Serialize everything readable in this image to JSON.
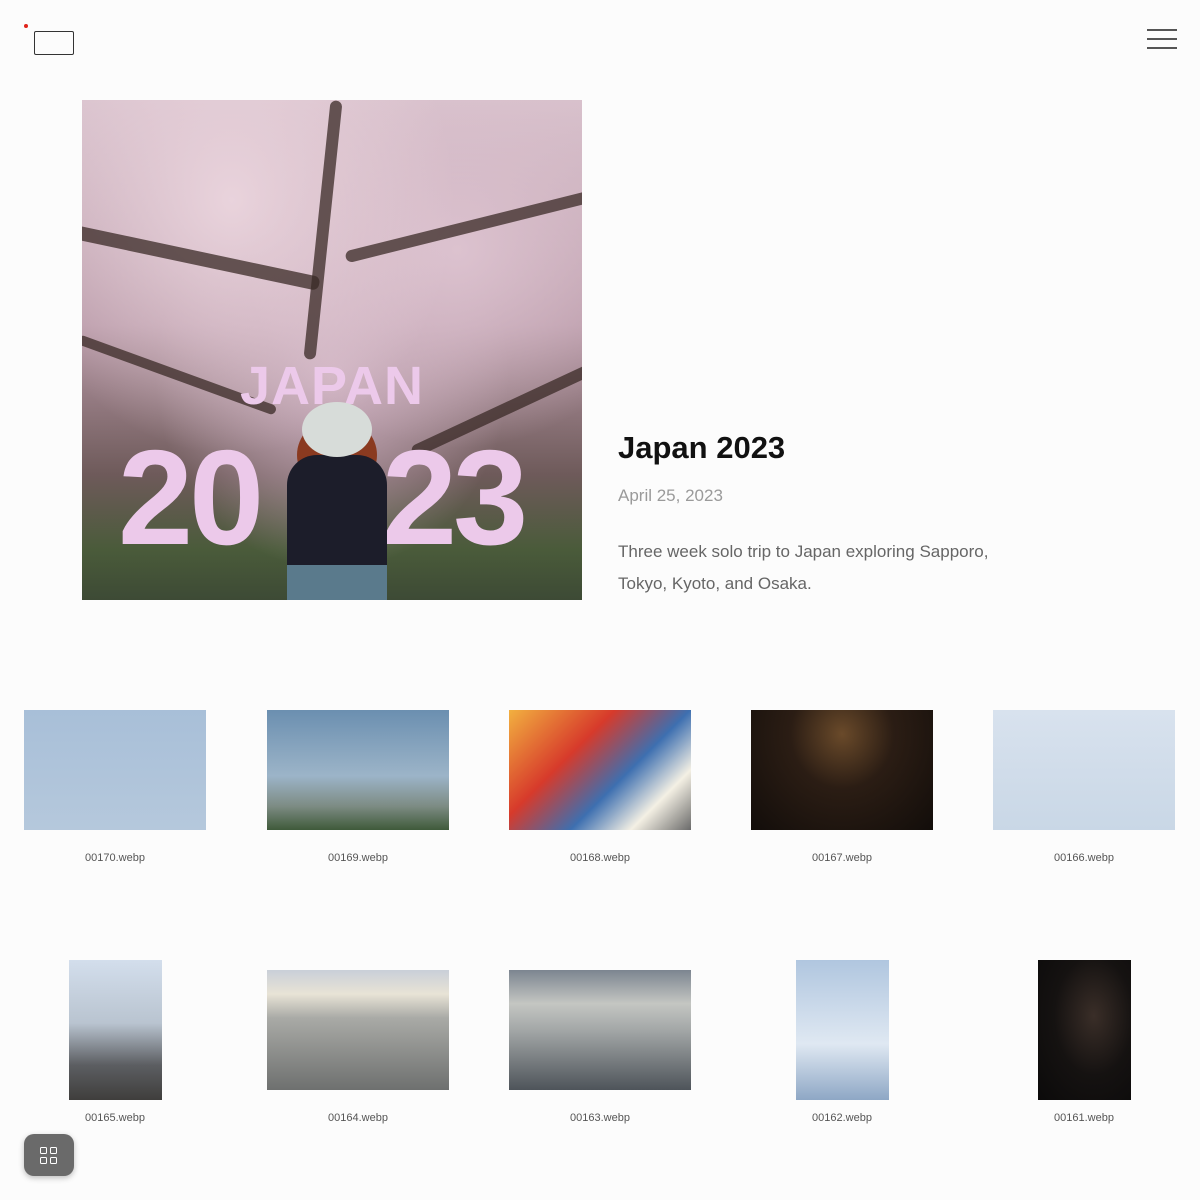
{
  "header": {
    "logo_icon": "logo-icon",
    "menu_icon": "hamburger-menu-icon"
  },
  "post": {
    "cover_text_line1": "JAPAN",
    "cover_text_line2_left": "20",
    "cover_text_line2_right": "23",
    "title": "Japan 2023",
    "date": "April 25, 2023",
    "description": "Three week solo trip to Japan exploring Sapporo, Tokyo, Kyoto, and Osaka."
  },
  "gallery": {
    "items": [
      {
        "filename": "00170.webp"
      },
      {
        "filename": "00169.webp"
      },
      {
        "filename": "00168.webp"
      },
      {
        "filename": "00167.webp"
      },
      {
        "filename": "00166.webp"
      },
      {
        "filename": "00165.webp"
      },
      {
        "filename": "00164.webp"
      },
      {
        "filename": "00163.webp"
      },
      {
        "filename": "00162.webp"
      },
      {
        "filename": "00161.webp"
      }
    ]
  },
  "fab": {
    "icon": "grid-icon"
  },
  "colors": {
    "accent_dot": "#e0241b",
    "cover_text": "#ecc9ea",
    "fab_background": "#6a6a6a"
  }
}
